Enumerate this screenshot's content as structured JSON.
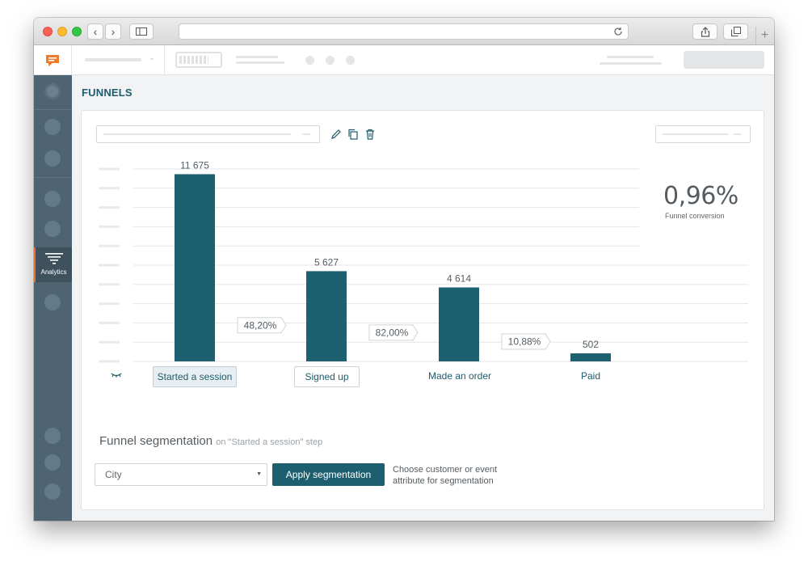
{
  "page": {
    "title": "FUNNELS"
  },
  "sidebar": {
    "active_label": "Analytics"
  },
  "conversion": {
    "value": "0,96%",
    "label": "Funnel conversion"
  },
  "segmentation": {
    "title": "Funnel segmentation",
    "subtitle": "on \"Started a session\" step",
    "select_value": "City",
    "apply_label": "Apply segmentation",
    "hint": "Choose customer or event attribute for segmentation"
  },
  "colors": {
    "bar": "#1d6070",
    "accent": "#e8712d",
    "sidebar": "#4f6472"
  },
  "chart_data": {
    "type": "bar",
    "categories": [
      "Started a session",
      "Signed up",
      "Made an order",
      "Paid"
    ],
    "values": [
      11675,
      5627,
      4614,
      502
    ],
    "value_labels": [
      "11 675",
      "5 627",
      "4 614",
      "502"
    ],
    "step_conversions": [
      "48,20%",
      "82,00%",
      "10,88%"
    ],
    "ylim": [
      0,
      12000
    ],
    "grid": true
  }
}
